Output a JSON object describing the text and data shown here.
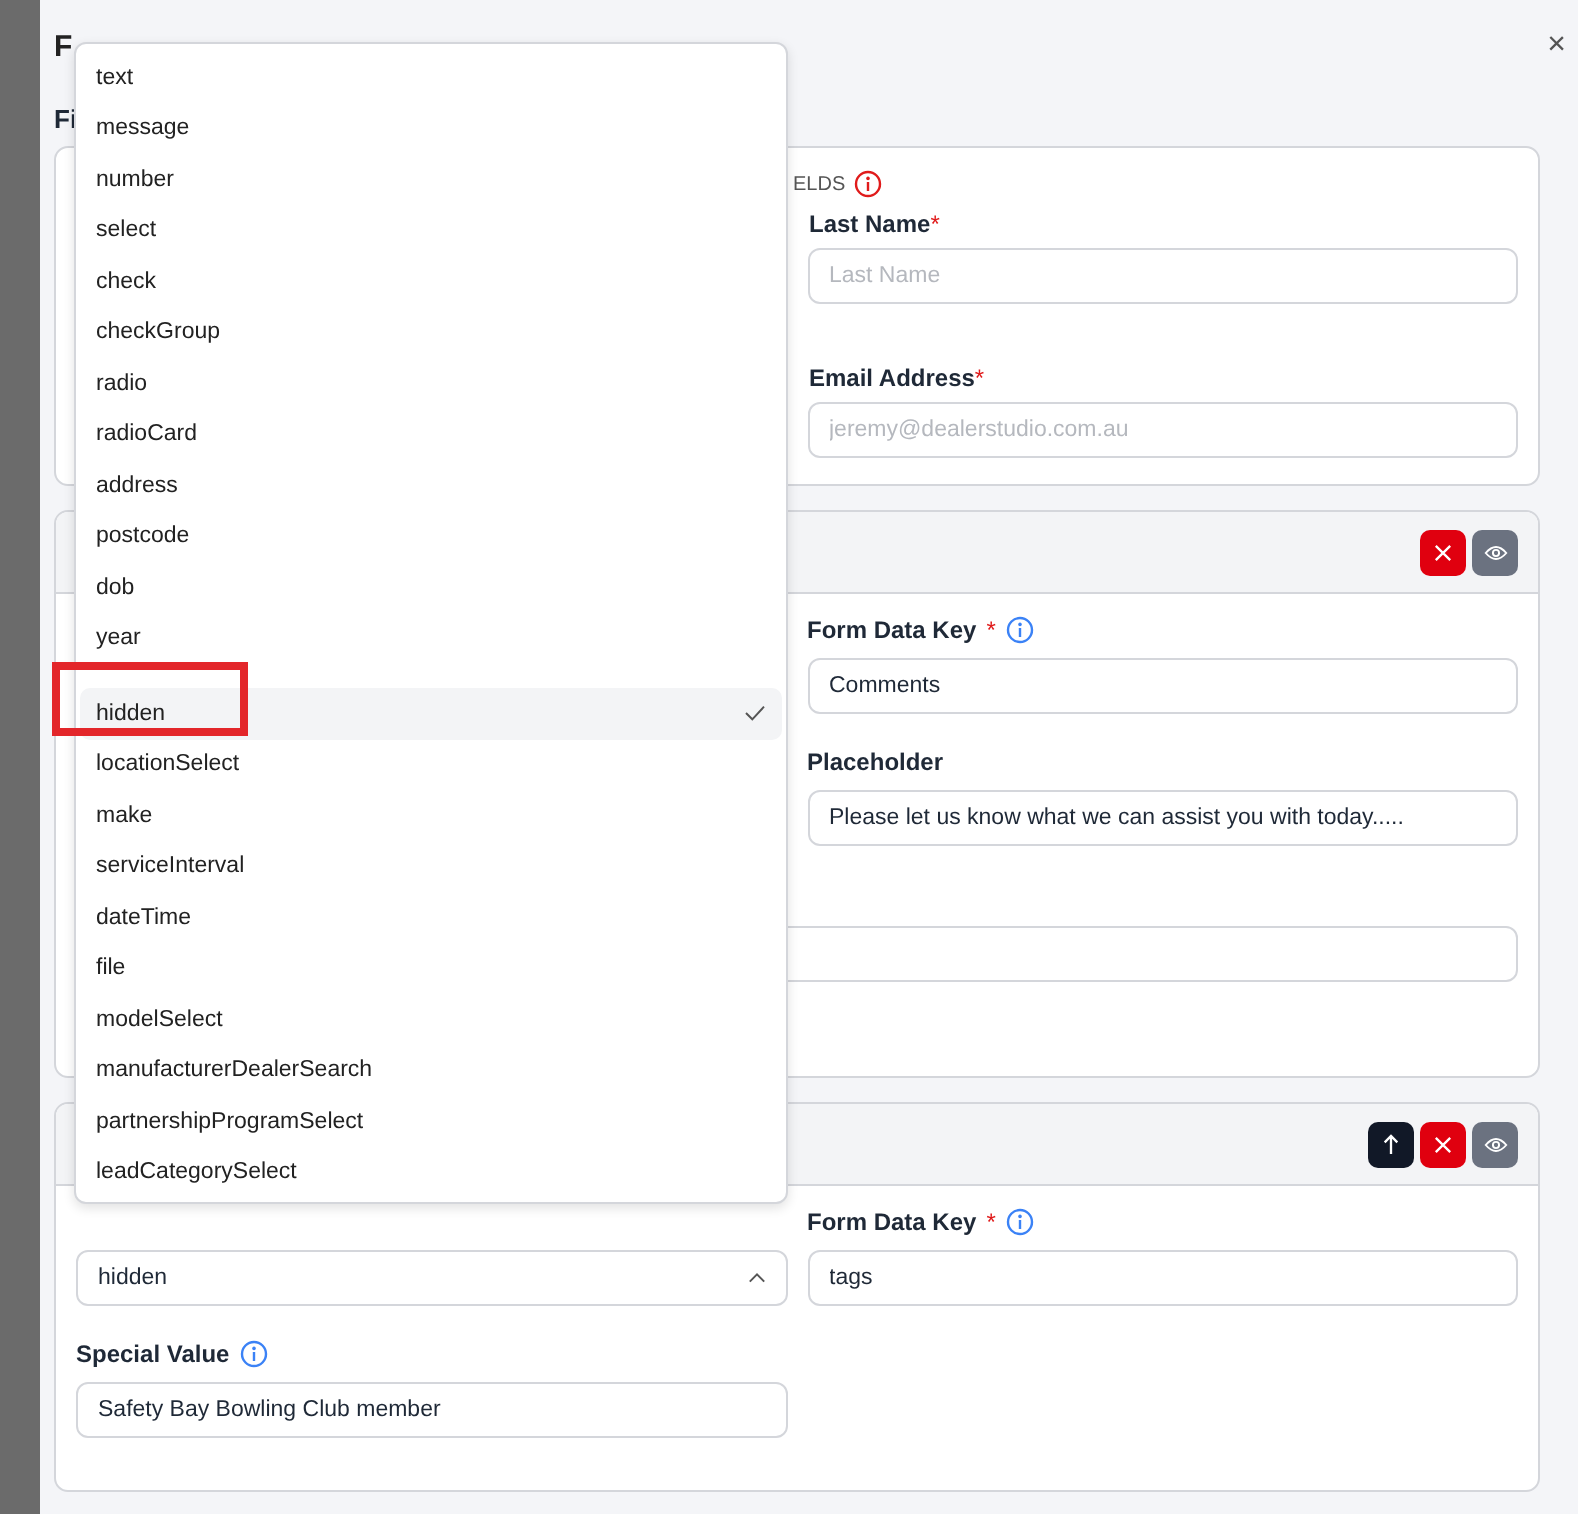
{
  "modal": {
    "title": "F",
    "section_heading": "Fi",
    "close": "×"
  },
  "required_card": {
    "heading": "ELDS",
    "fields": [
      {
        "label": "Last Name",
        "required_mark": "*",
        "placeholder": "Last Name"
      },
      {
        "label": "Email Address",
        "required_mark": "*",
        "placeholder": "jeremy@dealerstudio.com.au"
      }
    ]
  },
  "message_card": {
    "buttons": [
      {
        "kind": "delete"
      },
      {
        "kind": "visibility"
      }
    ],
    "fields": [
      {
        "label": "Form Data Key",
        "required_mark": "*",
        "info": true,
        "value": "Comments"
      },
      {
        "label": "Placeholder",
        "value": "Please let us know what we can assist you with today....."
      }
    ]
  },
  "hidden_card": {
    "buttons": [
      {
        "kind": "move-up"
      },
      {
        "kind": "delete"
      },
      {
        "kind": "visibility"
      }
    ],
    "type_select": {
      "value": "hidden",
      "expanded": true
    },
    "data_key": {
      "label": "Form Data Key",
      "required_mark": "*",
      "info": true,
      "value": "tags"
    },
    "special_value": {
      "label": "Special Value",
      "info": true,
      "value": "Safety Bay Bowling Club member"
    }
  },
  "dropdown": {
    "options": [
      {
        "label": "text",
        "selected": false
      },
      {
        "label": "message",
        "selected": false
      },
      {
        "label": "number",
        "selected": false
      },
      {
        "label": "select",
        "selected": false
      },
      {
        "label": "check",
        "selected": false
      },
      {
        "label": "checkGroup",
        "selected": false
      },
      {
        "label": "radio",
        "selected": false
      },
      {
        "label": "radioCard",
        "selected": false
      },
      {
        "label": "address",
        "selected": false
      },
      {
        "label": "postcode",
        "selected": false
      },
      {
        "label": "dob",
        "selected": false
      },
      {
        "label": "year",
        "selected": false
      },
      {
        "label": "hidden",
        "selected": true,
        "highlighted": true
      },
      {
        "label": "locationSelect",
        "selected": false
      },
      {
        "label": "make",
        "selected": false
      },
      {
        "label": "serviceInterval",
        "selected": false
      },
      {
        "label": "dateTime",
        "selected": false
      },
      {
        "label": "file",
        "selected": false
      },
      {
        "label": "modelSelect",
        "selected": false
      },
      {
        "label": "manufacturerDealerSearch",
        "selected": false
      },
      {
        "label": "partnershipProgramSelect",
        "selected": false
      },
      {
        "label": "leadCategorySelect",
        "selected": false
      }
    ]
  }
}
